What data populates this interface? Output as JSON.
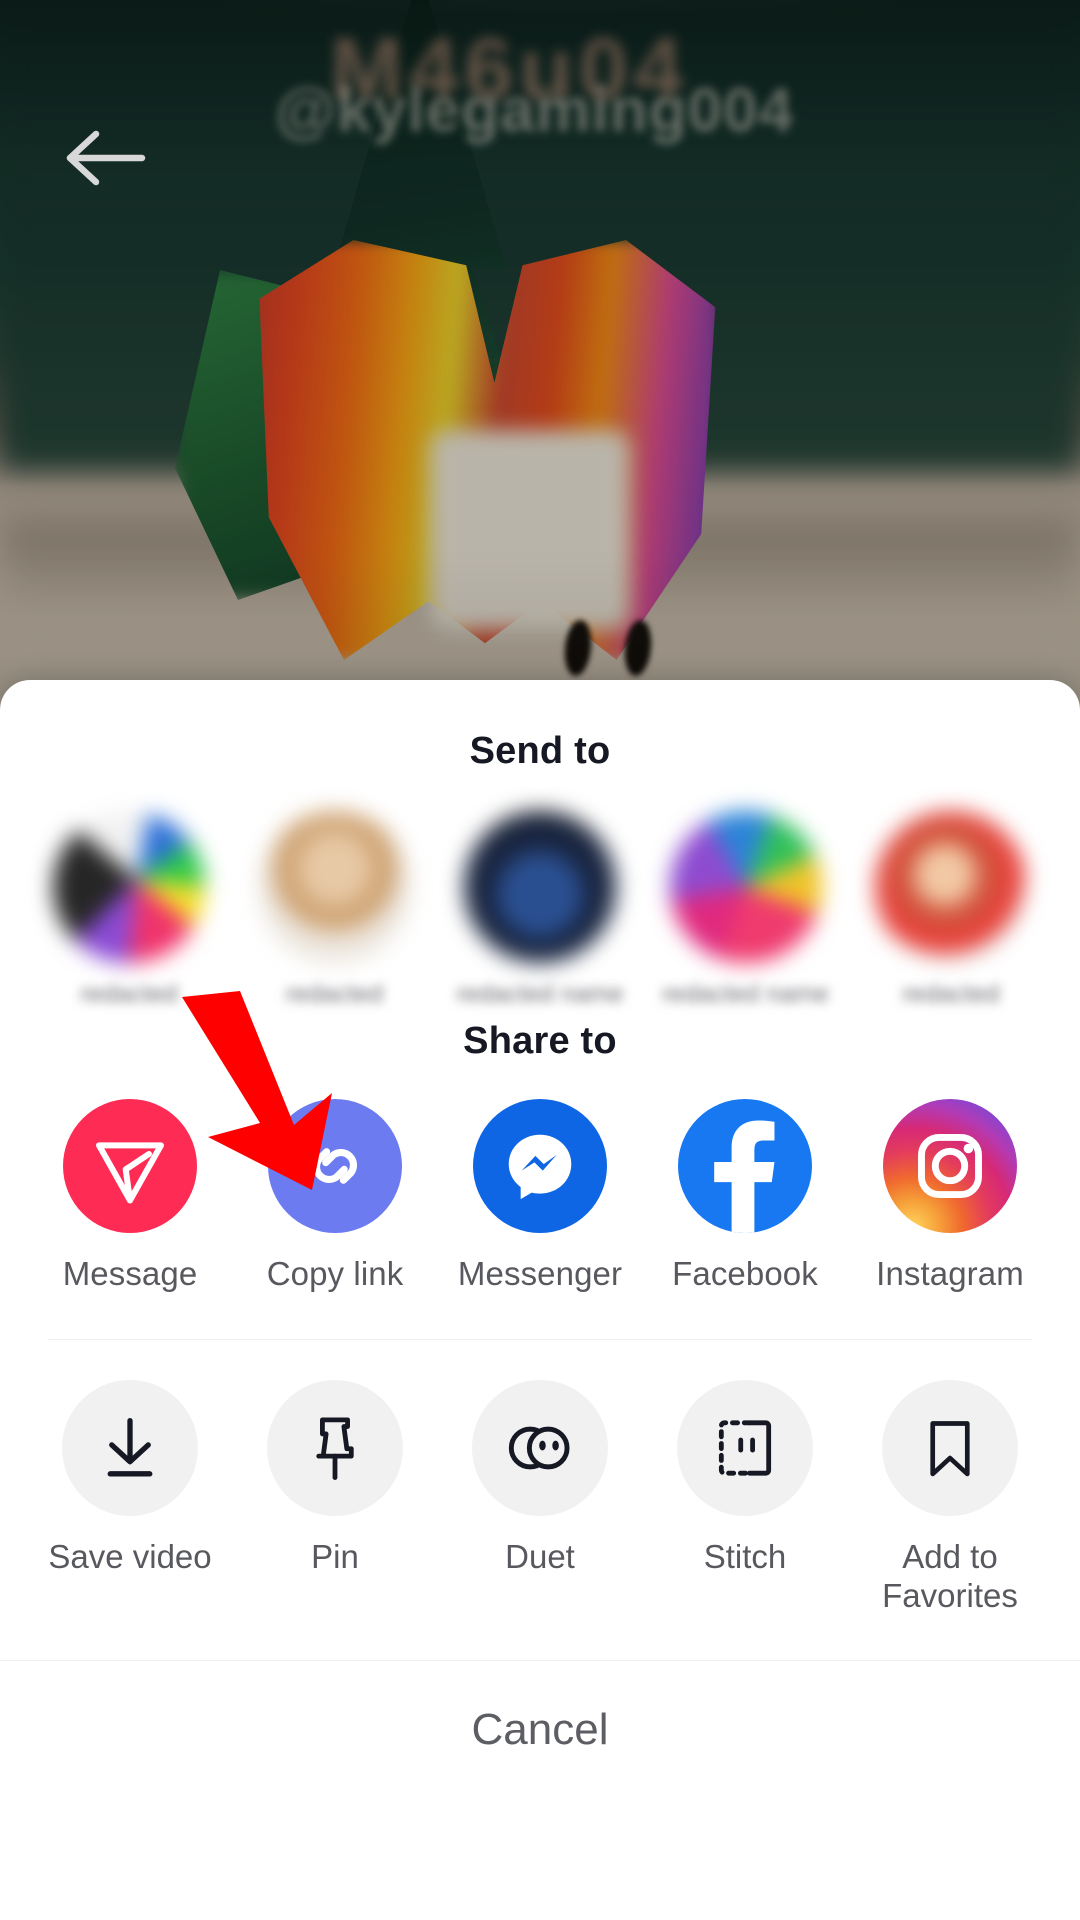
{
  "video": {
    "watermark_top": "M46u04",
    "watermark_user": "@kylegaming004",
    "back_icon": "back-arrow-icon"
  },
  "sheet": {
    "send_to_title": "Send to",
    "share_to_title": "Share to",
    "cancel_label": "Cancel"
  },
  "friends": [
    {
      "name": "redacted",
      "avatar": "avatar-1"
    },
    {
      "name": "redacted",
      "avatar": "avatar-2"
    },
    {
      "name": "redacted name",
      "avatar": "avatar-3"
    },
    {
      "name": "redacted name",
      "avatar": "avatar-4"
    },
    {
      "name": "redacted",
      "avatar": "avatar-5"
    }
  ],
  "share_targets": [
    {
      "label": "Message",
      "icon": "paper-plane-icon",
      "color": "#FE2C55"
    },
    {
      "label": "Copy link",
      "icon": "link-chain-icon",
      "color": "#6C7BF0"
    },
    {
      "label": "Messenger",
      "icon": "messenger-icon",
      "color": "#0F66E4"
    },
    {
      "label": "Facebook",
      "icon": "facebook-icon",
      "color": "#1778F2"
    },
    {
      "label": "Instagram",
      "icon": "instagram-icon",
      "color": "#C13584"
    }
  ],
  "actions": [
    {
      "label": "Save video",
      "icon": "download-icon"
    },
    {
      "label": "Pin",
      "icon": "pin-icon"
    },
    {
      "label": "Duet",
      "icon": "duet-icon"
    },
    {
      "label": "Stitch",
      "icon": "stitch-icon"
    },
    {
      "label": "Add to\nFavorites",
      "icon": "bookmark-icon"
    }
  ],
  "annotation": {
    "arrow_color": "#FF0000",
    "points_to": "Copy link"
  },
  "colors": {
    "sheet_bg": "#FFFFFF",
    "title_text": "#161823",
    "label_text": "#58595F",
    "action_circle_bg": "#F1F1F2",
    "divider": "#EDEDEE"
  }
}
